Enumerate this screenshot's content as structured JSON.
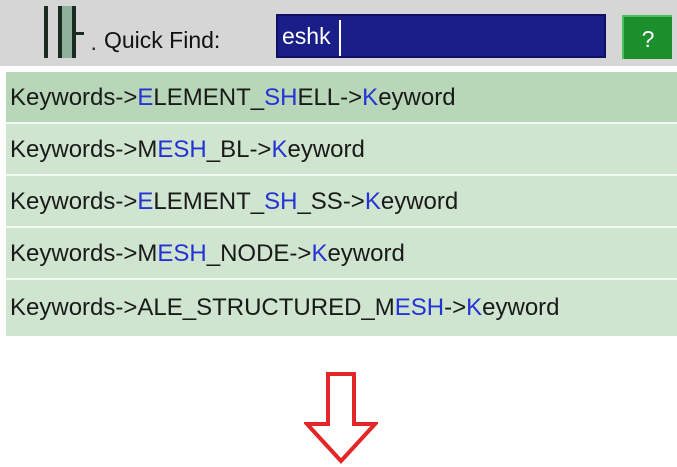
{
  "quick_find": {
    "label": "Quick Find:",
    "value": "eshk",
    "help_label": "?"
  },
  "results": [
    [
      "Keywords->",
      {
        "h": "E"
      },
      "LEMENT_",
      {
        "h": "SH"
      },
      "ELL->",
      {
        "h": "K"
      },
      "eyword"
    ],
    [
      "Keywords->M",
      {
        "h": "ESH"
      },
      "_BL->",
      {
        "h": "K"
      },
      "eyword"
    ],
    [
      "Keywords->",
      {
        "h": "E"
      },
      "LEMENT_",
      {
        "h": "SH"
      },
      "_SS->",
      {
        "h": "K"
      },
      "eyword"
    ],
    [
      "Keywords->M",
      {
        "h": "ESH"
      },
      "_NODE->",
      {
        "h": "K"
      },
      "eyword"
    ],
    [
      "Keywords->ALE_STRUCTURED_M",
      {
        "h": "ESH"
      },
      "->",
      {
        "h": "K"
      },
      "eyword"
    ]
  ],
  "colors": {
    "highlight": "#2432d6",
    "arrow": "#e32626",
    "input_bg": "#1a1e88",
    "help_bg": "#1b8f2c"
  },
  "icons": {
    "arrow": "down-arrow-icon",
    "grip": "toolbar-grip-icon"
  }
}
